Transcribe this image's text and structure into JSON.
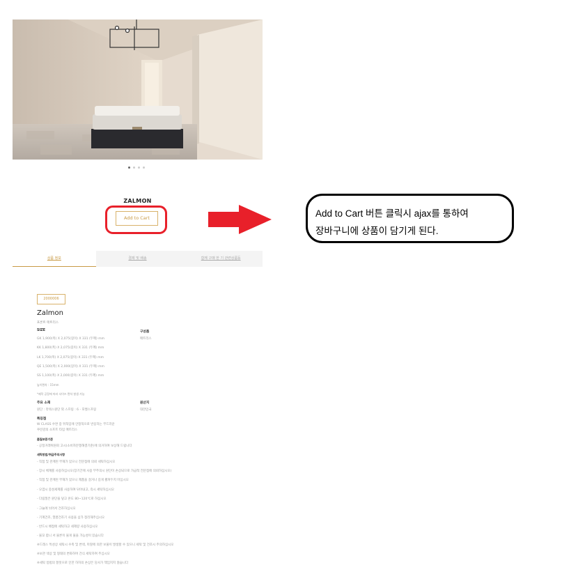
{
  "product": {
    "name": "ZALMON",
    "add_to_cart": "Add to Cart",
    "slider_total": 4,
    "slider_active": 1
  },
  "callout": {
    "line1": "Add to Cart 버튼 클릭시 ajax를 통하여",
    "line2": "장바구니에 상품이 담기게 된다."
  },
  "tabs": [
    "상품 정보",
    "결제 및 배송",
    "함께 구매 한 기 관련상품등"
  ],
  "detail": {
    "code": "2000006",
    "title": "Zalmon",
    "subtitle": "프론트 매트리스",
    "size_label": "SIZE",
    "sizes": [
      "GK 1,900(폭) X 2,075(길이) X 331 (두께) mm",
      "KK 1,800(폭) X 2,075(길이) X 331 (두께) mm",
      "LK 1,700(폭) X 2,075(길이) X 331 (두께) mm",
      "QE 1,500(폭) X 2,000(길이) X 331 (두께) mm",
      "SS 1,100(폭) X 2,000(길이) X 331 (두께) mm"
    ],
    "composition_label": "구성품",
    "composition_value": "매트리스",
    "note1": "높이편차 : 15mm",
    "note2": "*제작 공정에 따라 사이즈 편차 발생 가능",
    "material_label": "주요 소재",
    "material_value": "원단 : 라텍스원단 외 스프링 : 6 - 포켓스프링",
    "origin_label": "원산지",
    "origin_value": "대한민국",
    "feature_label": "특징점",
    "features": [
      "W CLASS 수면 중 뒤척임에 안정적으로 반응하는 부드러운",
      "쿠션감의 소프트 타입 매트리스"
    ],
    "warranty_label": "품질보증기준",
    "warranty_value": "- 공정거래위원회 고시(소비자분쟁해결기준)에 의거하여 보상해 드립니다",
    "care_label": "세탁방법/취급주의사항",
    "care": [
      "- 직접 및 관계된 부재가 있으니 전문점에 의뢰 세탁하십시오",
      "- 장시 체계를 사용하십시오(장기간에 사용 부주의시 원단이 손상되므로 가급적 전문점에 의뢰하십시오)",
      "- 직접 및 관계된 부재가 있으니 제품을 걸거나 길게 펼쳐두지 마십시오",
      "- 오염시 중성세제를 사용하여 닦아내고, 즉시 세탁하십시오",
      "- 다림질은 원단을 덮고 온도 80~120℃로 하십시오",
      "- 그늘에 뉘어서 건조하십시오",
      "- 기계건조, 열풍건조기 사용을 삼가 정리해주십시오",
      "- 반드시 배접에 세탁하고 세제량 사용하십시오",
      "- 물꼬 합니 서 물론이 물게 물을 가능성이 있습니다",
      "※드레스 특성상 세탁시 수축 및 변색, 마찰에 의한 보풀이 발생할 수 있으니 세탁 및 건조시 주의하십시오",
      "※보관 색상 및 형태의 변화하며 건식 세탁하여 주십시오",
      "※세탁 방법의 잘못으로 인한 하자의 손상은 당사가 책임지지 않습니다"
    ]
  },
  "colors": {
    "accent": "#c89a45",
    "highlight": "#e8202a"
  }
}
